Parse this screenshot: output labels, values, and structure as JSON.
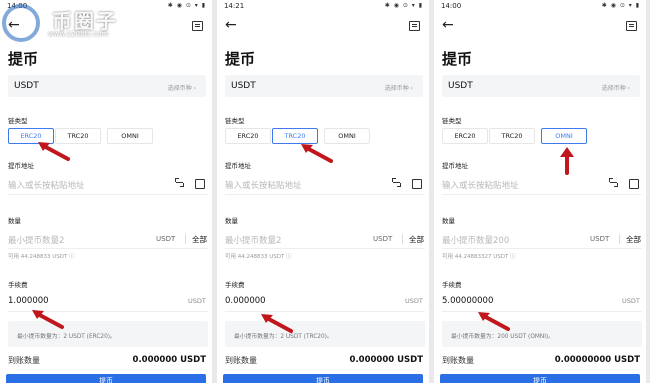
{
  "watermark": {
    "brand": "币圈子",
    "url": "www.120btc.com"
  },
  "screens": [
    {
      "time": "14:00",
      "status_icons": "✱ ◉ ⊙ ▾ ▮",
      "title": "提币",
      "coin": "USDT",
      "select_coin": "选择币种 ›",
      "chain_label": "链类型",
      "chains": [
        "ERC20",
        "TRC20",
        "OMNI"
      ],
      "selected_chain": "ERC20",
      "address_label": "提币地址",
      "address_placeholder": "输入或长按粘贴地址",
      "amount_label": "数量",
      "amount_placeholder": "最小提币数量2",
      "amount_unit": "USDT",
      "all": "全部",
      "available": "可用 44.248833 USDT ⓘ",
      "fee_label": "手续费",
      "fee": "1.000000",
      "fee_unit": "USDT",
      "tip": "最小提币数量为：2 USDT (ERC20)。",
      "receive_label": "到账数量",
      "receive_value": "0.000000 USDT",
      "submit": "提币"
    },
    {
      "time": "14:21",
      "status_icons": "✱ ◉ ⊙ ▾ ▮",
      "title": "提币",
      "coin": "USDT",
      "select_coin": "选择币种 ›",
      "chain_label": "链类型",
      "chains": [
        "ERC20",
        "TRC20",
        "OMNI"
      ],
      "selected_chain": "TRC20",
      "address_label": "提币地址",
      "address_placeholder": "输入或长按粘贴地址",
      "amount_label": "数量",
      "amount_placeholder": "最小提币数量2",
      "amount_unit": "USDT",
      "all": "全部",
      "available": "可用 44.248833 USDT ⓘ",
      "fee_label": "手续费",
      "fee": "0.000000",
      "fee_unit": "USDT",
      "tip": "最小提币数量为：2 USDT (TRC20)。",
      "receive_label": "到账数量",
      "receive_value": "0.000000 USDT",
      "submit": "提币"
    },
    {
      "time": "14:00",
      "status_icons": "✱ ◉ ⊙ ▾ ▮",
      "title": "提币",
      "coin": "USDT",
      "select_coin": "选择币种 ›",
      "chain_label": "链类型",
      "chains": [
        "ERC20",
        "TRC20",
        "OMNI"
      ],
      "selected_chain": "OMNI",
      "address_label": "提币地址",
      "address_placeholder": "输入或长按粘贴地址",
      "amount_label": "数量",
      "amount_placeholder": "最小提币数量200",
      "amount_unit": "USDT",
      "all": "全部",
      "available": "可用 44.24883327 USDT ⓘ",
      "fee_label": "手续费",
      "fee": "5.00000000",
      "fee_unit": "USDT",
      "tip": "最小提币数量为：200 USDT (OMNI)。",
      "receive_label": "到账数量",
      "receive_value": "0.00000000 USDT",
      "submit": "提币"
    }
  ],
  "colors": {
    "accent": "#3f7bef",
    "arrow": "#c0161c",
    "submit": "#2a6fe6"
  }
}
